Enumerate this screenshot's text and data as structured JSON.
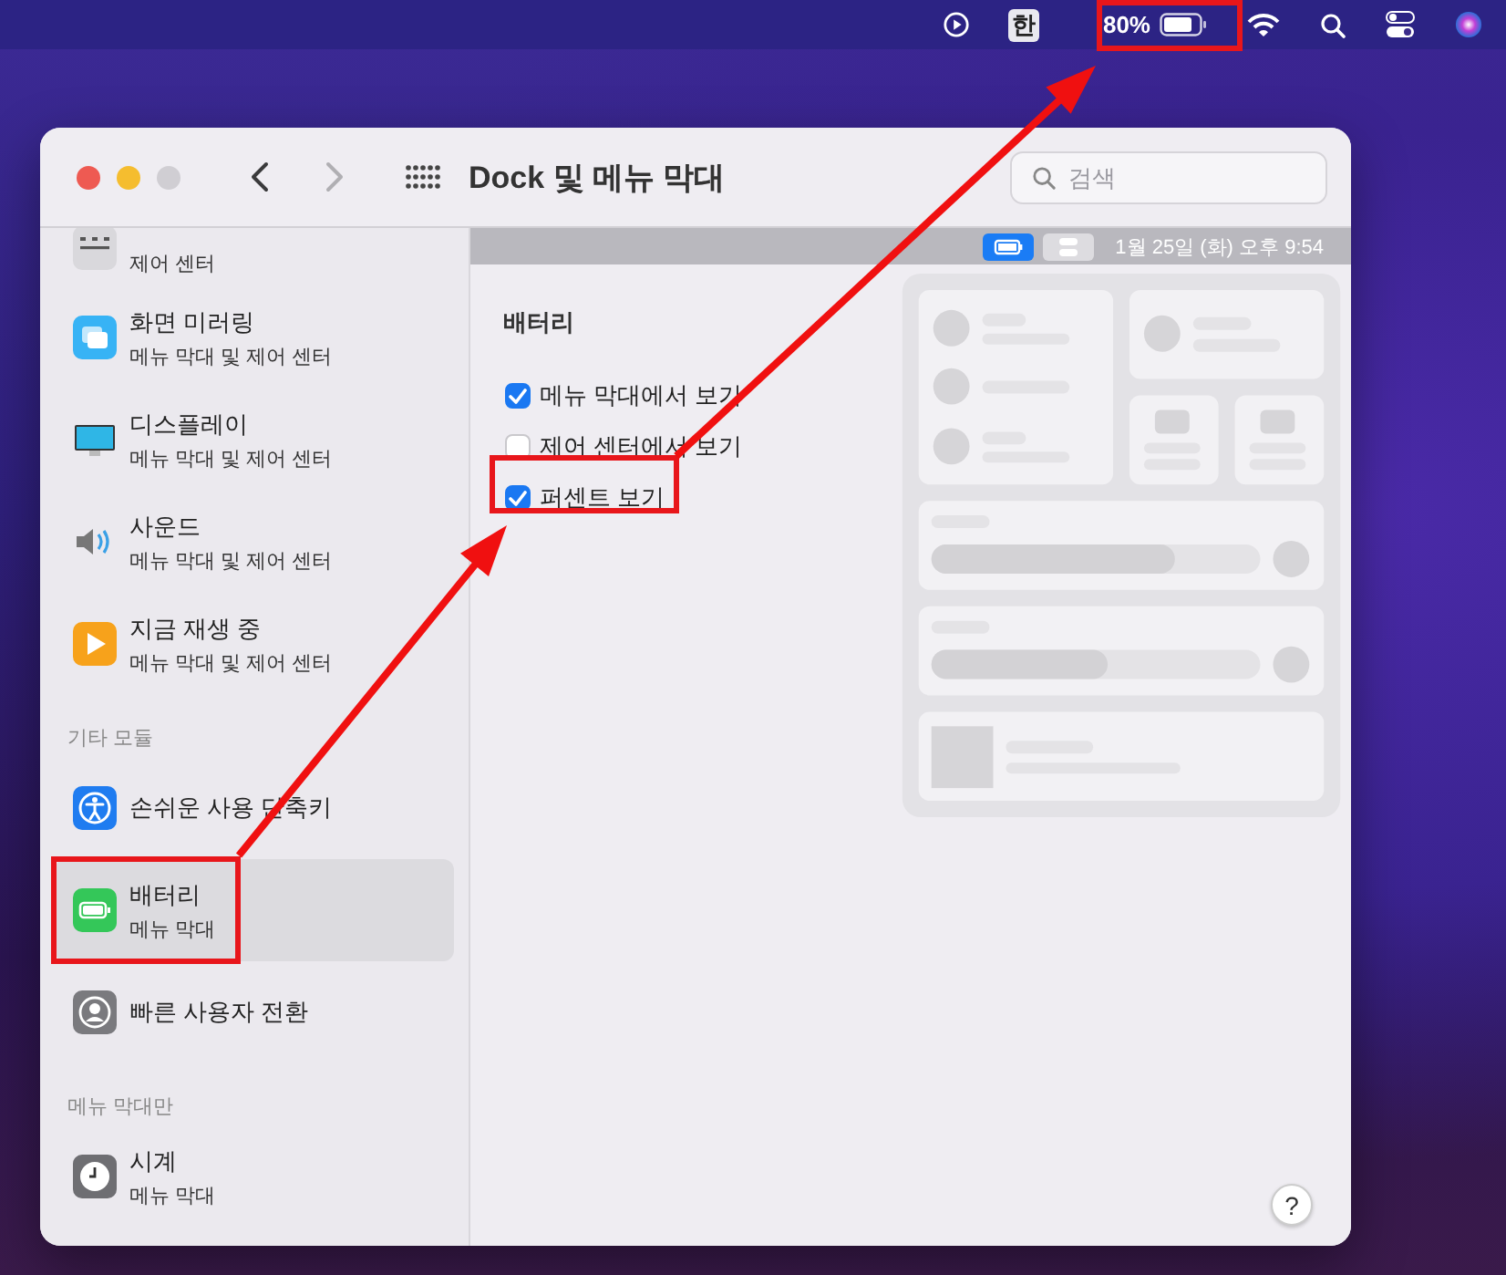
{
  "menu_bar": {
    "input_source": "한",
    "battery_percent": "80%"
  },
  "window": {
    "title": "Dock 및 메뉴 막대",
    "search": {
      "placeholder": "검색"
    },
    "nav": [
      {
        "kind": "back",
        "disabled": false
      },
      {
        "kind": "forward",
        "disabled": true
      }
    ]
  },
  "sidebar": {
    "items": [
      {
        "kind": "cut",
        "subtitle": "제어 센터",
        "selected": false
      },
      {
        "kind": "item",
        "title": "화면 미러링",
        "subtitle": "메뉴 막대 및 제어 센터",
        "selected": false
      },
      {
        "kind": "item",
        "title": "디스플레이",
        "subtitle": "메뉴 막대 및 제어 센터",
        "selected": false
      },
      {
        "kind": "item",
        "title": "사운드",
        "subtitle": "메뉴 막대 및 제어 센터",
        "selected": false
      },
      {
        "kind": "item",
        "title": "지금 재생 중",
        "subtitle": "메뉴 막대 및 제어 센터",
        "selected": false
      },
      {
        "kind": "header",
        "title": "기타 모듈"
      },
      {
        "kind": "item",
        "title": "손쉬운 사용 단축키",
        "selected": false
      },
      {
        "kind": "item",
        "title": "배터리",
        "subtitle": "메뉴 막대",
        "selected": true
      },
      {
        "kind": "item",
        "title": "빠른 사용자 전환",
        "selected": false
      },
      {
        "kind": "header",
        "title": "메뉴 막대만"
      },
      {
        "kind": "item",
        "title": "시계",
        "subtitle": "메뉴 막대",
        "selected": false
      }
    ]
  },
  "content": {
    "preview_clock": "1월 25일 (화) 오후 9:54",
    "section_title": "배터리",
    "options": [
      {
        "label": "메뉴 막대에서 보기",
        "checked": true
      },
      {
        "label": "제어 센터에서 보기",
        "checked": false
      },
      {
        "label": "퍼센트 보기",
        "checked": true
      }
    ],
    "help": "?"
  }
}
